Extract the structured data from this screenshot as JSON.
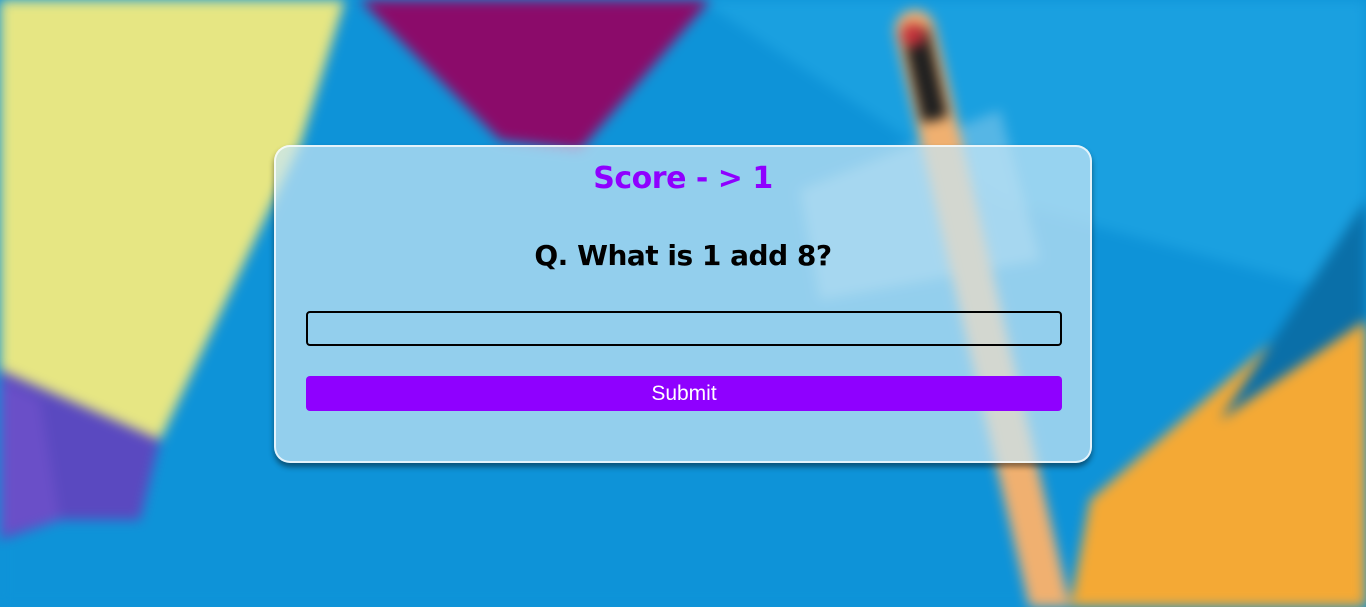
{
  "quiz": {
    "score_text": "Score - > 1",
    "question_text": "Q. What is 1 add 8?",
    "answer_value": "",
    "submit_label": "Submit"
  },
  "colors": {
    "accent": "#8f00ff",
    "question": "#000000",
    "button_text": "#ffffff"
  },
  "background_icon": "blurred-paper-and-pencil-photo"
}
